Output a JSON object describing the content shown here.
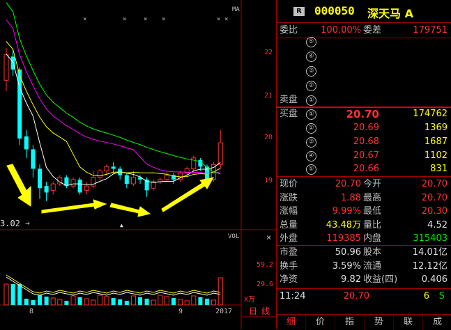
{
  "chart": {
    "ma_label": "MA",
    "vol_label": "VOL",
    "price_ticks": [
      "22",
      "21",
      "20",
      "19"
    ],
    "vol_ticks": [
      "59.2",
      "29.6"
    ],
    "vol_unit": "X万",
    "x_labels": [
      "8",
      "9",
      "2017"
    ],
    "low_label": "3.02",
    "period_tabs": [
      "日",
      "线"
    ]
  },
  "header": {
    "badge": "R",
    "code": "000050",
    "name": "深天马 A"
  },
  "weibi": {
    "label": "委比",
    "value": "100.00%",
    "diff_label": "委差",
    "diff_value": "179751"
  },
  "sell": {
    "label": "卖盘",
    "levels": [
      "⑤",
      "④",
      "③",
      "②",
      "①"
    ]
  },
  "buy": {
    "label": "买盘",
    "rows": [
      {
        "n": "①",
        "price": "20.70",
        "vol": "174762"
      },
      {
        "n": "②",
        "price": "20.69",
        "vol": "1369"
      },
      {
        "n": "③",
        "price": "20.68",
        "vol": "1687"
      },
      {
        "n": "④",
        "price": "20.67",
        "vol": "1102"
      },
      {
        "n": "⑤",
        "price": "20.66",
        "vol": "831"
      }
    ]
  },
  "quote": [
    {
      "l1": "现价",
      "v1": "20.70",
      "c1": "red",
      "l2": "今开",
      "v2": "20.70",
      "c2": "red"
    },
    {
      "l1": "涨跌",
      "v1": "1.88",
      "c1": "red",
      "l2": "最高",
      "v2": "20.70",
      "c2": "red"
    },
    {
      "l1": "涨幅",
      "v1": "9.99%",
      "c1": "red",
      "l2": "最低",
      "v2": "20.30",
      "c2": "red"
    },
    {
      "l1": "总量",
      "v1": "43.48万",
      "c1": "yel",
      "l2": "量比",
      "v2": "4.52",
      "c2": "white"
    },
    {
      "l1": "外盘",
      "v1": "119385",
      "c1": "red",
      "l2": "内盘",
      "v2": "315403",
      "c2": "green"
    }
  ],
  "fund": [
    {
      "l1": "市盈",
      "v1": "50.96",
      "l2": "股本",
      "v2": "14.01亿"
    },
    {
      "l1": "换手",
      "v1": "3.59%",
      "l2": "流通",
      "v2": "12.12亿"
    },
    {
      "l1": "净资",
      "v1": "9.82",
      "l2": "收益(四)",
      "v2": "0.406"
    }
  ],
  "tick": {
    "time": "11:24",
    "price": "20.70",
    "vol": "6",
    "side": "S"
  },
  "tabs": [
    "细",
    "价",
    "指",
    "势",
    "联",
    "成"
  ],
  "colors": {
    "up": "#ff3232",
    "down": "#00ffff",
    "ma5": "#ffffff",
    "ma10": "#ffff00",
    "ma20": "#ff00ff",
    "ma30": "#00ff00",
    "annotation": "#ffff00",
    "grid": "#a00000"
  },
  "candles": [
    [
      21.35,
      21.95,
      21.1,
      22.1
    ],
    [
      21.9,
      21.6,
      21.45,
      22.05
    ],
    [
      21.6,
      20.0,
      19.85,
      21.65
    ],
    [
      20.05,
      19.75,
      19.55,
      20.2
    ],
    [
      19.75,
      19.3,
      19.1,
      19.85
    ],
    [
      19.3,
      18.85,
      18.6,
      19.4
    ],
    [
      18.9,
      18.75,
      18.55,
      19.0
    ],
    [
      18.8,
      18.95,
      18.7,
      19.0
    ],
    [
      18.95,
      19.1,
      18.9,
      19.15
    ],
    [
      19.1,
      18.9,
      18.85,
      19.15
    ],
    [
      18.9,
      19.05,
      18.85,
      19.1
    ],
    [
      19.05,
      18.75,
      18.7,
      19.1
    ],
    [
      18.8,
      18.9,
      18.7,
      19.0
    ],
    [
      18.9,
      19.1,
      18.85,
      19.25
    ],
    [
      19.1,
      19.25,
      19.05,
      19.3
    ],
    [
      19.25,
      19.35,
      19.15,
      19.4
    ],
    [
      19.35,
      19.3,
      19.2,
      19.45
    ],
    [
      19.3,
      19.15,
      19.05,
      19.35
    ],
    [
      19.15,
      18.95,
      18.85,
      19.2
    ],
    [
      18.95,
      19.1,
      18.9,
      19.25
    ],
    [
      19.1,
      19.05,
      18.95,
      19.15
    ],
    [
      19.05,
      18.8,
      18.65,
      19.1
    ],
    [
      18.85,
      19.0,
      18.8,
      19.05
    ],
    [
      19.0,
      19.05,
      18.95,
      19.1
    ],
    [
      19.05,
      19.15,
      19.0,
      19.25
    ],
    [
      19.15,
      19.05,
      18.95,
      19.2
    ],
    [
      19.05,
      19.2,
      19.0,
      19.25
    ],
    [
      19.2,
      19.3,
      19.15,
      19.35
    ],
    [
      19.3,
      19.55,
      19.2,
      19.6
    ],
    [
      19.5,
      19.35,
      19.25,
      19.55
    ],
    [
      19.35,
      19.05,
      18.95,
      19.4
    ],
    [
      19.05,
      19.4,
      19.0,
      19.45
    ],
    [
      19.4,
      19.9,
      19.3,
      20.2
    ]
  ]
}
